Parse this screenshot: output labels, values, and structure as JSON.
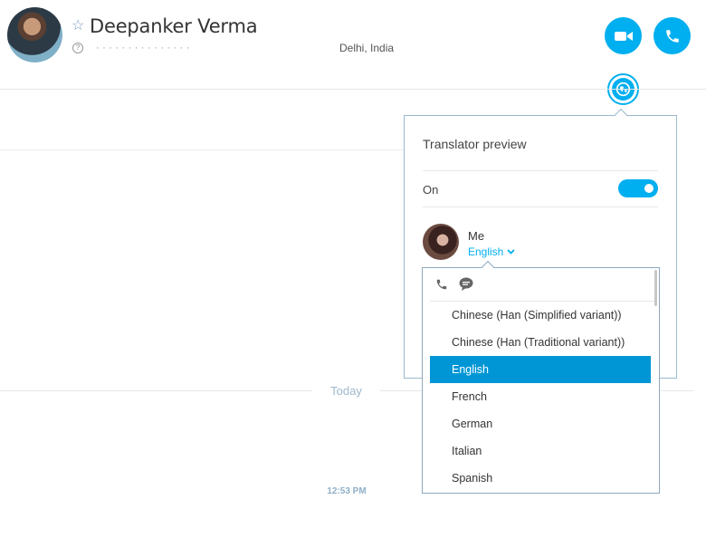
{
  "header": {
    "contact_name": "Deepanker Verma",
    "mood_message": "· · · ·  ·  ·  ·  ·  ·  ·  ·  ·  ·  ·  ·",
    "location": "Delhi, India",
    "info_glyph": "?",
    "star_glyph": "☆"
  },
  "conversation": {
    "date_divider": "Today",
    "timestamp": "12:53 PM"
  },
  "translator": {
    "title": "Translator preview",
    "toggle_label": "On",
    "toggle_on": true,
    "user_label": "Me",
    "selected_language": "English"
  },
  "language_dropdown": {
    "options": [
      "Chinese (Han (Simplified variant))",
      "Chinese (Han (Traditional variant))",
      "English",
      "French",
      "German",
      "Italian",
      "Spanish"
    ],
    "selected": "English"
  },
  "colors": {
    "accent": "#00aff0",
    "selected_row": "#0096d6"
  },
  "icons": [
    "star-icon",
    "info-icon",
    "video-camera-icon",
    "phone-icon",
    "translator-globe-icon",
    "chevron-down-icon",
    "chat-bubble-icon"
  ]
}
